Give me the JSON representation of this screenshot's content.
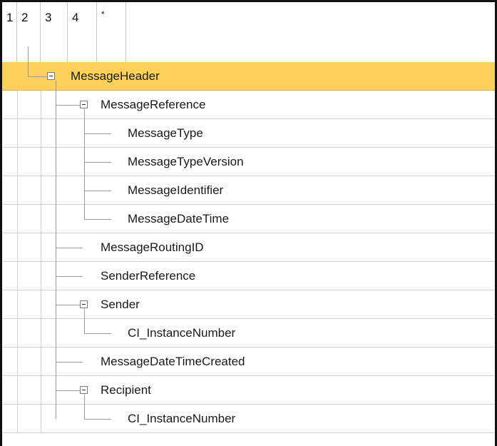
{
  "levels": [
    "1",
    "2",
    "3",
    "4",
    "*"
  ],
  "nodes": [
    {
      "label": "MessageHeader",
      "level": 1,
      "expandable": true,
      "selected": true
    },
    {
      "label": "MessageReference",
      "level": 2,
      "expandable": true
    },
    {
      "label": "MessageType",
      "level": 3,
      "expandable": false
    },
    {
      "label": "MessageTypeVersion",
      "level": 3,
      "expandable": false
    },
    {
      "label": "MessageIdentifier",
      "level": 3,
      "expandable": false
    },
    {
      "label": "MessageDateTime",
      "level": 3,
      "expandable": false
    },
    {
      "label": "MessageRoutingID",
      "level": 2,
      "expandable": false
    },
    {
      "label": "SenderReference",
      "level": 2,
      "expandable": false
    },
    {
      "label": "Sender",
      "level": 2,
      "expandable": true
    },
    {
      "label": "CI_InstanceNumber",
      "level": 3,
      "expandable": false
    },
    {
      "label": "MessageDateTimeCreated",
      "level": 2,
      "expandable": false
    },
    {
      "label": "Recipient",
      "level": 2,
      "expandable": true
    },
    {
      "label": "CI_InstanceNumber",
      "level": 3,
      "expandable": false
    }
  ],
  "colors": {
    "selected": "#fbd15b",
    "grid": "#cfcfcf"
  }
}
